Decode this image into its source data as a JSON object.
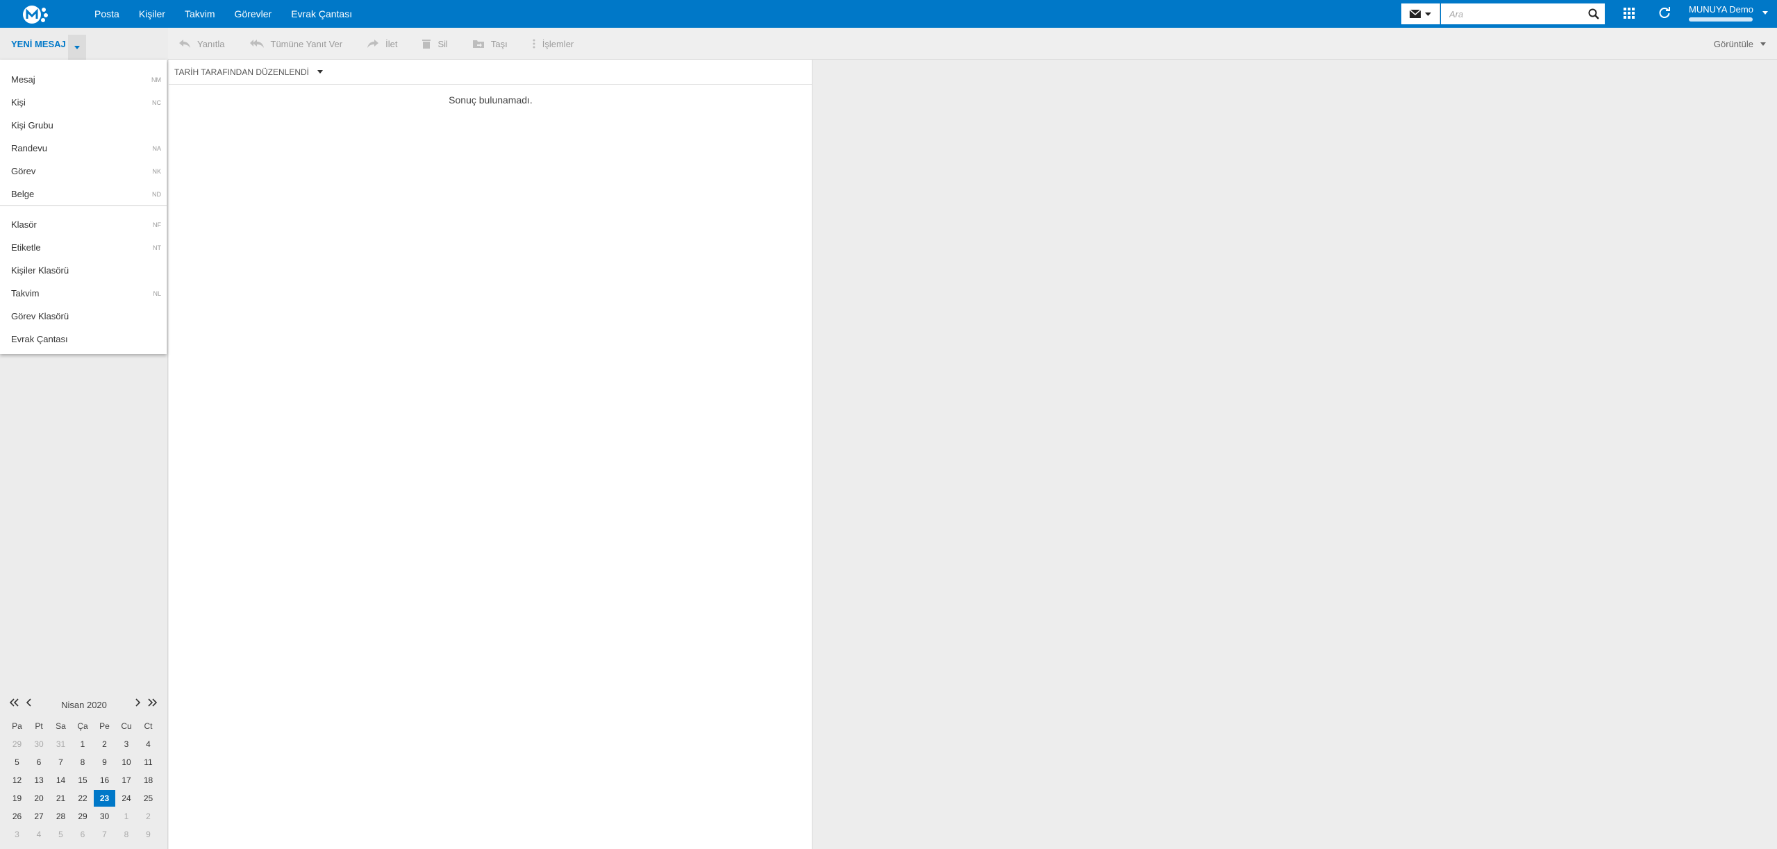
{
  "header": {
    "nav": [
      "Posta",
      "Kişiler",
      "Takvim",
      "Görevler",
      "Evrak Çantası"
    ],
    "search_placeholder": "Ara",
    "user_name": "MUNUYA Demo"
  },
  "toolbar": {
    "new_message_label": "YENİ MESAJ",
    "actions": [
      "Yanıtla",
      "Tümüne Yanıt Ver",
      "İlet",
      "Sil",
      "Taşı",
      "İşlemler"
    ],
    "view_label": "Görüntüle"
  },
  "new_menu": {
    "items": [
      {
        "label": "Mesaj",
        "key": "NM"
      },
      {
        "label": "Kişi",
        "key": "NC"
      },
      {
        "label": "Kişi Grubu",
        "key": ""
      },
      {
        "label": "Randevu",
        "key": "NA"
      },
      {
        "label": "Görev",
        "key": "NK"
      },
      {
        "label": "Belge",
        "key": "ND"
      },
      {
        "label": "Klasör",
        "key": "NF"
      },
      {
        "label": "Etiketle",
        "key": "NT"
      },
      {
        "label": "Kişiler Klasörü",
        "key": ""
      },
      {
        "label": "Takvim",
        "key": "NL"
      },
      {
        "label": "Görev Klasörü",
        "key": ""
      },
      {
        "label": "Evrak Çantası",
        "key": ""
      }
    ]
  },
  "list": {
    "sort_label": "TARİH TARAFINDAN DÜZENLENDİ",
    "empty_text": "Sonuç bulunamadı."
  },
  "calendar": {
    "title": "Nisan 2020",
    "weekdays": [
      "Pa",
      "Pt",
      "Sa",
      "Ça",
      "Pe",
      "Cu",
      "Ct"
    ],
    "weeks": [
      [
        "29",
        "30",
        "31",
        "1",
        "2",
        "3",
        "4"
      ],
      [
        "5",
        "6",
        "7",
        "8",
        "9",
        "10",
        "11"
      ],
      [
        "12",
        "13",
        "14",
        "15",
        "16",
        "17",
        "18"
      ],
      [
        "19",
        "20",
        "21",
        "22",
        "23",
        "24",
        "25"
      ],
      [
        "26",
        "27",
        "28",
        "29",
        "30",
        "1",
        "2"
      ],
      [
        "3",
        "4",
        "5",
        "6",
        "7",
        "8",
        "9"
      ]
    ],
    "selected_day": "23"
  },
  "colors": {
    "accent": "#0078c8"
  }
}
